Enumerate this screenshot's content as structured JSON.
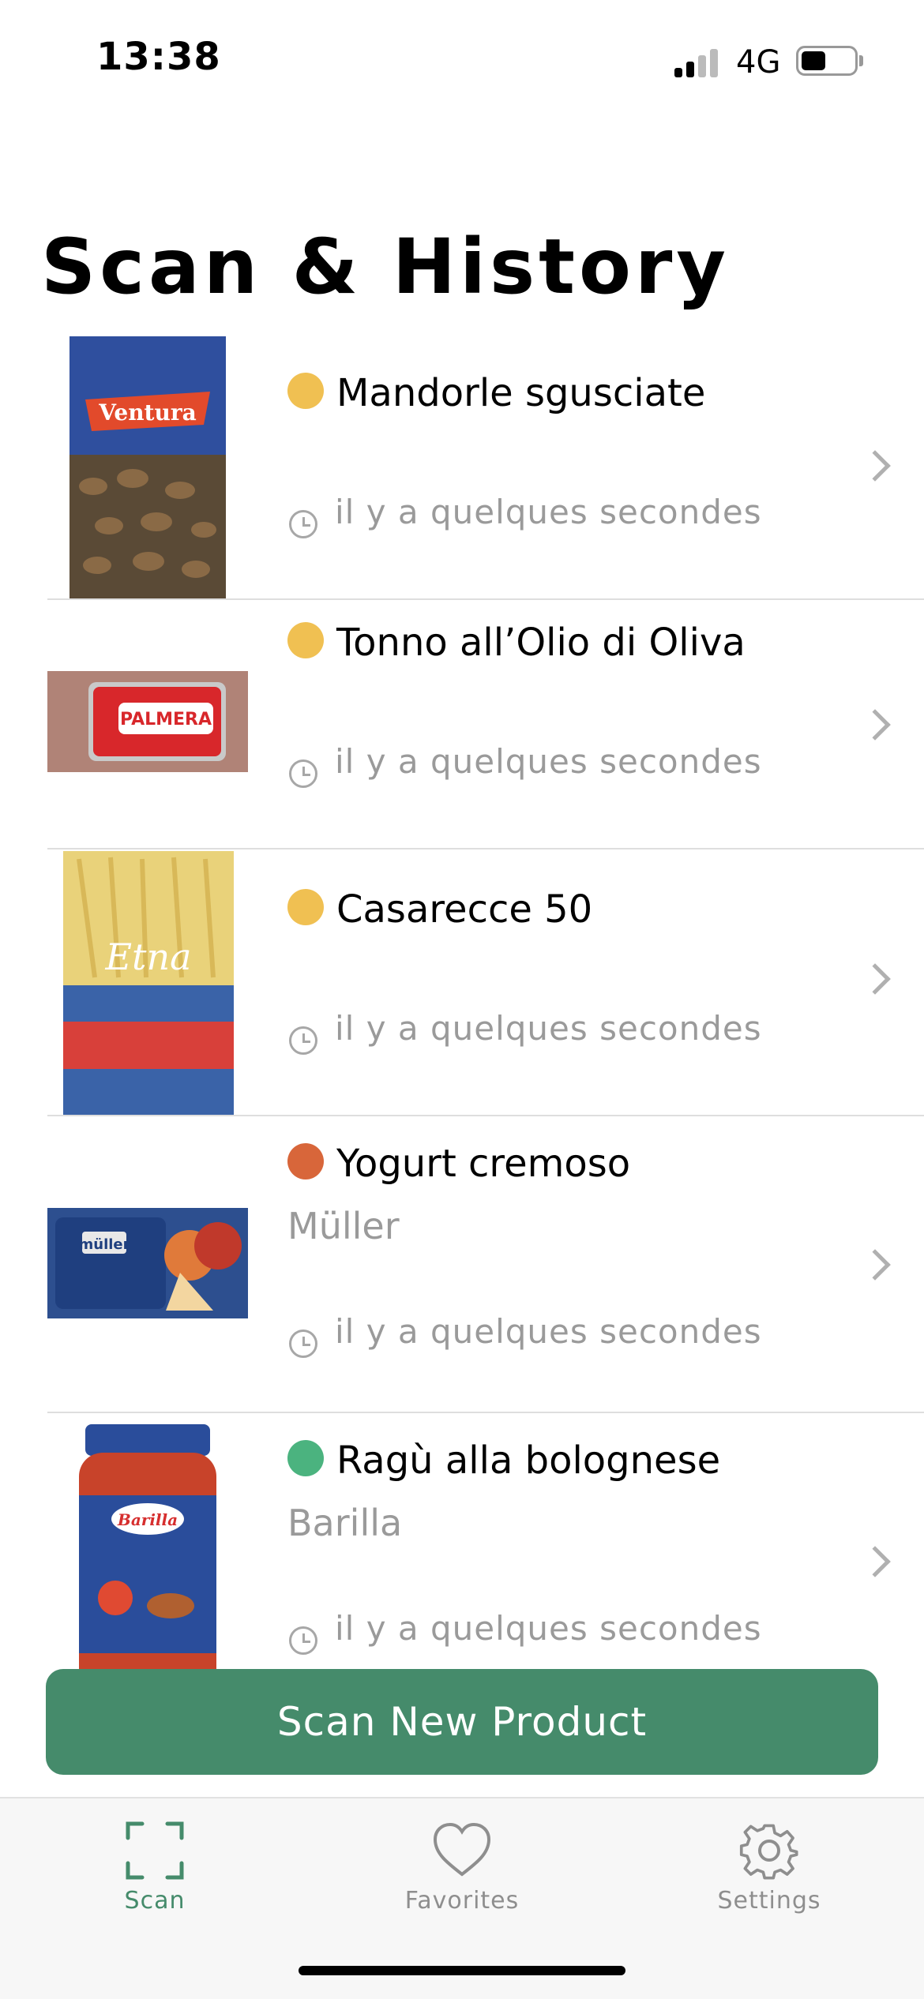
{
  "status": {
    "time": "13:38",
    "network": "4G"
  },
  "page": {
    "title": "Scan & History"
  },
  "history": [
    {
      "name": "Mandorle sgusciate",
      "brand": "",
      "time_ago": "il y a quelques secondes",
      "dot_color": "#f0c052",
      "thumb_label": "Ventura"
    },
    {
      "name": "Tonno all’Olio di Oliva",
      "brand": "",
      "time_ago": "il y a quelques secondes",
      "dot_color": "#f0c052",
      "thumb_label": "PALMERA"
    },
    {
      "name": "Casarecce 50",
      "brand": "",
      "time_ago": "il y a quelques secondes",
      "dot_color": "#f0c052",
      "thumb_label": "Etna"
    },
    {
      "name": "Yogurt cremoso",
      "brand": "Müller",
      "time_ago": "il y a quelques secondes",
      "dot_color": "#d8663a",
      "thumb_label": "müller"
    },
    {
      "name": "Ragù alla bolognese",
      "brand": "Barilla",
      "time_ago": "il y a quelques secondes",
      "dot_color": "#4bb37f",
      "thumb_label": "Barilla"
    }
  ],
  "actions": {
    "scan_new_label": "Scan New Product"
  },
  "tabs": [
    {
      "label": "Scan",
      "icon": "scan-icon",
      "active": true
    },
    {
      "label": "Favorites",
      "icon": "heart-icon",
      "active": false
    },
    {
      "label": "Settings",
      "icon": "gear-icon",
      "active": false
    }
  ],
  "colors": {
    "accent": "#458b6b",
    "inactive": "#8e8e8e"
  }
}
